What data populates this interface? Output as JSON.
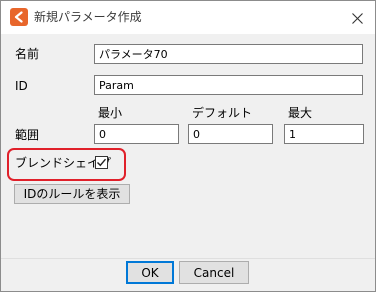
{
  "window": {
    "title": "新規パラメータ作成",
    "close_symbol": "✕"
  },
  "form": {
    "name_label": "名前",
    "name_value": "パラメータ70",
    "id_label": "ID",
    "id_value": "Param",
    "range_label": "範囲",
    "min_label": "最小",
    "default_label": "デフォルト",
    "max_label": "最大",
    "min_value": "0",
    "default_value": "0",
    "max_value": "1",
    "blend_shape_label": "ブレンドシェイプ",
    "blend_shape_checked": true,
    "id_rules_button": "IDのルールを表示"
  },
  "footer": {
    "ok_label": "OK",
    "cancel_label": "Cancel"
  },
  "colors": {
    "accent": "#e8662b",
    "highlight": "#e0202a",
    "focus": "#0078d7"
  }
}
